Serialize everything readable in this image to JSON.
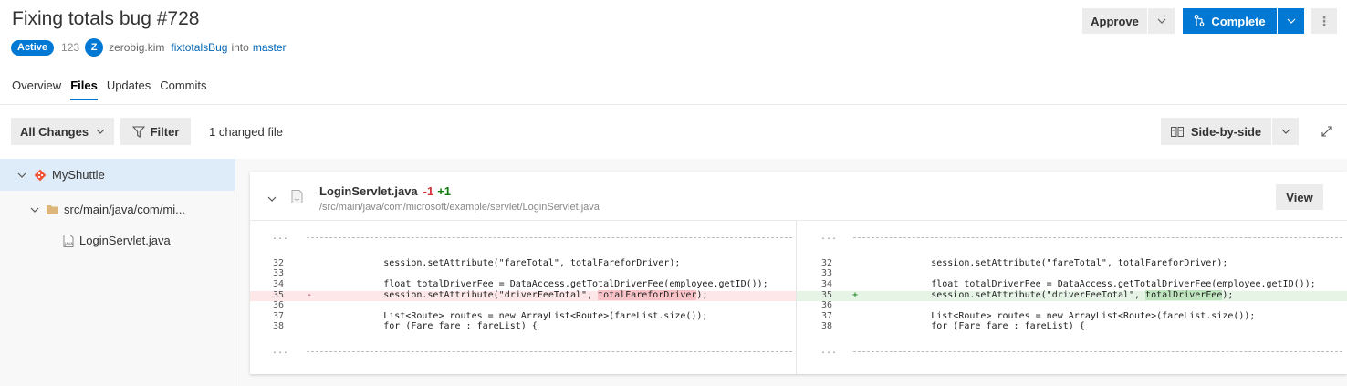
{
  "pr": {
    "title": "Fixing totals bug #728",
    "status": "Active",
    "id": "123",
    "avatar_initial": "Z",
    "author": "zerobig.kim",
    "source_branch": "fixtotalsBug",
    "into": "into",
    "target_branch": "master"
  },
  "actions": {
    "approve": "Approve",
    "complete": "Complete",
    "more": "⋮"
  },
  "tabs": [
    {
      "label": "Overview",
      "active": false
    },
    {
      "label": "Files",
      "active": true
    },
    {
      "label": "Updates",
      "active": false
    },
    {
      "label": "Commits",
      "active": false
    }
  ],
  "toolbar": {
    "all_changes": "All Changes",
    "filter": "Filter",
    "changed_count": "1 changed file",
    "view_mode": "Side-by-side"
  },
  "tree": {
    "repo": "MyShuttle",
    "folder": "src/main/java/com/mi...",
    "file": "LoginServlet.java"
  },
  "file": {
    "name": "LoginServlet.java",
    "deletions": "-1",
    "additions": "+1",
    "path": "/src/main/java/com/microsoft/example/servlet/LoginServlet.java",
    "view_label": "View"
  },
  "diff": {
    "skip_marker": "...",
    "left": [
      {
        "num": "32",
        "text": "            session.setAttribute(\"fareTotal\", totalFareforDriver);"
      },
      {
        "num": "33",
        "text": ""
      },
      {
        "num": "34",
        "text": "            float totalDriverFee = DataAccess.getTotalDriverFee(employee.getID());"
      },
      {
        "num": "35",
        "text": "            session.setAttribute(\"driverFeeTotal\", ",
        "mark": "totalFareforDriver",
        "tail": ");",
        "sign": "-"
      },
      {
        "num": "36",
        "text": ""
      },
      {
        "num": "37",
        "text": "            List<Route> routes = new ArrayList<Route>(fareList.size());"
      },
      {
        "num": "38",
        "text": "            for (Fare fare : fareList) {"
      }
    ],
    "right": [
      {
        "num": "32",
        "text": "            session.setAttribute(\"fareTotal\", totalFareforDriver);"
      },
      {
        "num": "33",
        "text": ""
      },
      {
        "num": "34",
        "text": "            float totalDriverFee = DataAccess.getTotalDriverFee(employee.getID());"
      },
      {
        "num": "35",
        "text": "            session.setAttribute(\"driverFeeTotal\", ",
        "mark": "totalDriverFee",
        "tail": ");",
        "sign": "+"
      },
      {
        "num": "36",
        "text": ""
      },
      {
        "num": "37",
        "text": "            List<Route> routes = new ArrayList<Route>(fareList.size());"
      },
      {
        "num": "38",
        "text": "            for (Fare fare : fareList) {"
      }
    ]
  },
  "colors": {
    "accent": "#0078d4",
    "deleted_line": "#fde7e9",
    "added_line": "#e6f4e6",
    "git_icon": "#f05133",
    "folder_icon": "#dcb67a"
  }
}
